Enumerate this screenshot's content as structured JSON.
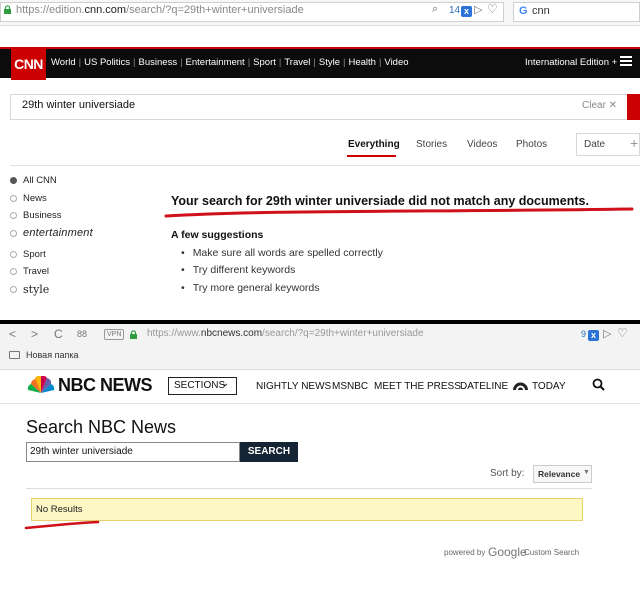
{
  "cnn_browser": {
    "url_prefix": "https://edition.",
    "url_host": "cnn.com",
    "url_path": "/search/?q=29th+winter+universiade",
    "tracker_count": "14",
    "badge_letter": "x",
    "search_engine_icon": "G",
    "search_text": "cnn"
  },
  "cnn": {
    "logo": "CNN",
    "nav": [
      "World",
      "US Politics",
      "Business",
      "Entertainment",
      "Sport",
      "Travel",
      "Style",
      "Health",
      "Video"
    ],
    "edition": "International Edition +",
    "query": "29th winter universiade",
    "clear_label": "Clear ✕",
    "tabs": [
      "Everything",
      "Stories",
      "Videos",
      "Photos"
    ],
    "date_label": "Date",
    "date_plus": "+",
    "filters": [
      {
        "label": "All CNN",
        "selected": true
      },
      {
        "label": "News",
        "selected": false
      },
      {
        "label": "Business",
        "selected": false
      },
      {
        "label": "entertainment",
        "selected": false
      },
      {
        "label": "Sport",
        "selected": false
      },
      {
        "label": "Travel",
        "selected": false
      },
      {
        "label": "style",
        "selected": false
      }
    ],
    "no_match": "Your search for 29th winter universiade did not match any documents.",
    "suggestions_title": "A few suggestions",
    "suggestions": [
      "Make sure all words are spelled correctly",
      "Try different keywords",
      "Try more general keywords"
    ]
  },
  "nbc_browser": {
    "back": "<",
    "forward": ">",
    "reload": "C",
    "grid": "88",
    "vpn": "VPN",
    "url_prefix": "https://www.",
    "url_host": "nbcnews.com",
    "url_path": "/search/?q=29th+winter+universiade",
    "tracker_count": "9",
    "badge_letter": "x",
    "bookmark_folder": "Новая папка"
  },
  "nbc": {
    "logo": "NBC NEWS",
    "sections_label": "SECTIONS",
    "links": [
      "NIGHTLY NEWS",
      "MSNBC",
      "MEET THE PRESS",
      "DATELINE",
      "TODAY"
    ],
    "title": "Search NBC News",
    "query": "29th winter universiade",
    "search_button": "SEARCH",
    "sort_label": "Sort by:",
    "sort_value": "Relevance",
    "no_results": "No Results",
    "powered_by": "powered by",
    "google": "Google",
    "custom_search": "Custom Search"
  },
  "colors": {
    "cnn_red": "#cc0000",
    "nbc_navy": "#142435",
    "notice_yellow": "#fdf7c4",
    "annotation_red": "#d0101a"
  }
}
